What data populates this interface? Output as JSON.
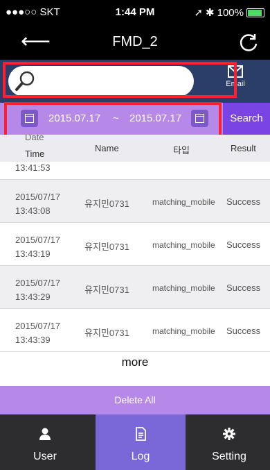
{
  "status_bar": {
    "carrier": "●●●○○ SKT",
    "time": "1:44 PM",
    "battery": "100%"
  },
  "nav": {
    "title": "FMD_2"
  },
  "search": {
    "placeholder": "",
    "email_label": "Email"
  },
  "date_filter": {
    "start": "2015.07.17",
    "separator": "~",
    "end": "2015.07.17",
    "search_label": "Search"
  },
  "table": {
    "headers": {
      "date_line1": "Date",
      "date_line2": "Time",
      "name": "Name",
      "type": "타입",
      "result": "Result"
    },
    "partial_time": "13:41:53",
    "rows": [
      {
        "date": "2015/07/17",
        "time": "13:43:08",
        "name": "유지민0731",
        "type": "matching_mobile",
        "result": "Success"
      },
      {
        "date": "2015/07/17",
        "time": "13:43:19",
        "name": "유지민0731",
        "type": "matching_mobile",
        "result": "Success"
      },
      {
        "date": "2015/07/17",
        "time": "13:43:29",
        "name": "유지민0731",
        "type": "matching_mobile",
        "result": "Success"
      },
      {
        "date": "2015/07/17",
        "time": "13:43:39",
        "name": "유지민0731",
        "type": "matching_mobile",
        "result": "Success"
      }
    ]
  },
  "more_label": "more",
  "delete_all_label": "Delete All",
  "tabs": [
    {
      "label": "User",
      "icon": "person-icon"
    },
    {
      "label": "Log",
      "icon": "document-icon",
      "active": true
    },
    {
      "label": "Setting",
      "icon": "gear-icon"
    }
  ]
}
